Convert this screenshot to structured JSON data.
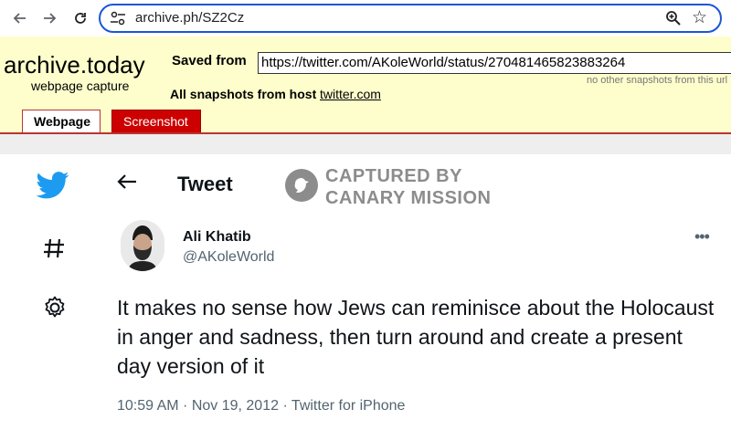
{
  "browser": {
    "url": "archive.ph/SZ2Cz"
  },
  "archive": {
    "logo": "archive.today",
    "subtitle": "webpage capture",
    "saved_from_label": "Saved from",
    "saved_from_url": "https://twitter.com/AKoleWorld/status/270481465823883264",
    "no_other_snapshots": "no other snapshots from this url",
    "all_snapshots_label": "All snapshots  from host",
    "all_snapshots_host": "twitter.com",
    "tabs": [
      {
        "label": "Webpage",
        "active": true
      },
      {
        "label": "Screenshot",
        "active": false
      }
    ]
  },
  "twitter": {
    "sidebar_icons": [
      "twitter-bird-icon",
      "hashtag-icon",
      "settings-gear-icon"
    ],
    "page_title": "Tweet",
    "watermark_line1": "CAPTURED BY",
    "watermark_line2": "CANARY MISSION",
    "author_name": "Ali Khatib",
    "author_handle": "@AKoleWorld",
    "tweet_text": "It makes no sense how Jews can reminisce about the Holocaust in anger and sadness, then turn around and create a present day version of it",
    "timestamp": "10:59 AM · Nov 19, 2012 · Twitter for iPhone",
    "more_label": "•••"
  },
  "colors": {
    "twitter_blue": "#1d9bf0",
    "archive_bg": "#fefecc",
    "archive_red": "#cc0000",
    "omnibox_focus": "#1a56d6"
  }
}
